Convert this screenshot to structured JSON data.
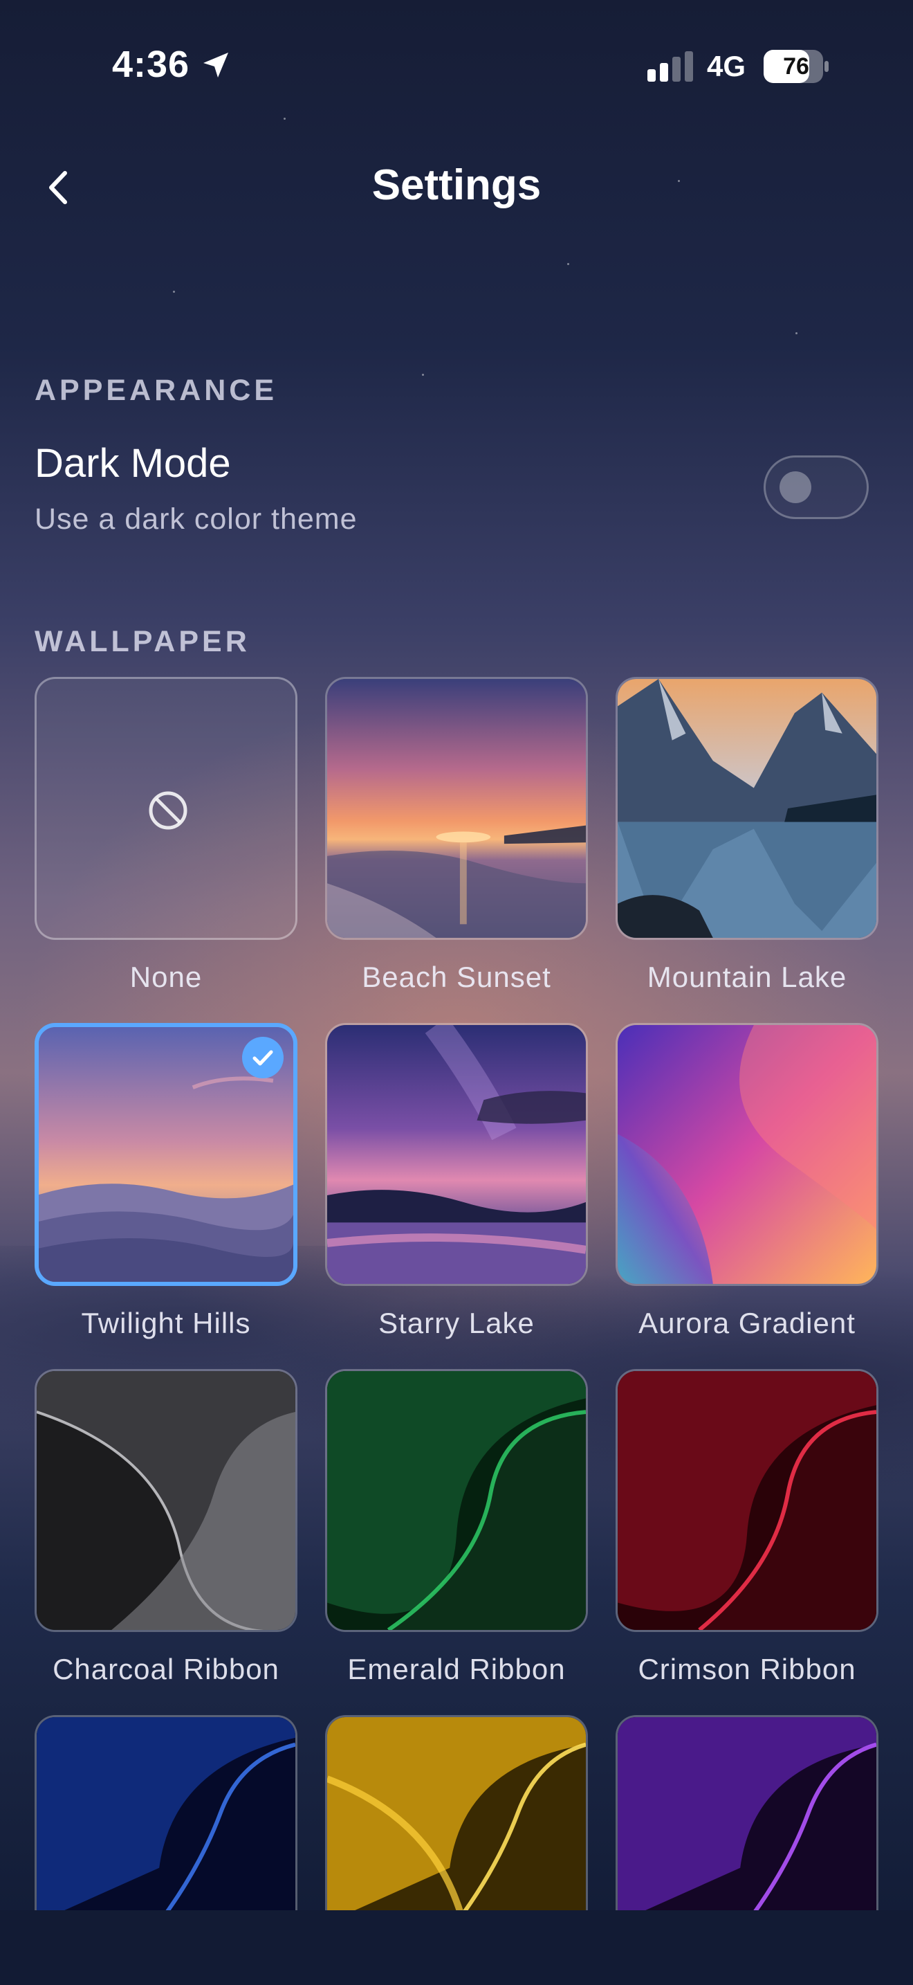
{
  "status_bar": {
    "time": "4:36",
    "network": "4G",
    "battery": "76"
  },
  "header": {
    "title": "Settings"
  },
  "appearance": {
    "section_title": "APPEARANCE",
    "dark_mode": {
      "title": "Dark Mode",
      "subtitle": "Use a dark color theme",
      "enabled": false
    }
  },
  "wallpaper": {
    "section_title": "WALLPAPER",
    "selected": "Twilight Hills",
    "items": [
      {
        "label": "None"
      },
      {
        "label": "Beach Sunset"
      },
      {
        "label": "Mountain Lake"
      },
      {
        "label": "Twilight Hills"
      },
      {
        "label": "Starry Lake"
      },
      {
        "label": "Aurora Gradient"
      },
      {
        "label": "Charcoal Ribbon"
      },
      {
        "label": "Emerald Ribbon"
      },
      {
        "label": "Crimson Ribbon"
      }
    ]
  },
  "colors": {
    "accent": "#5aa8ff",
    "background_top": "#161d36",
    "background_bottom": "#101a33"
  }
}
